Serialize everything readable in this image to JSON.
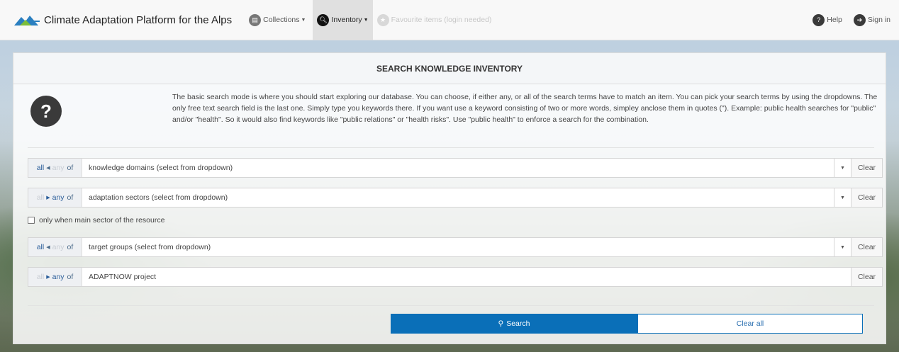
{
  "nav": {
    "brand": "Climate Adaptation Platform for the Alps",
    "collections": "Collections",
    "inventory": "Inventory",
    "favourites": "Favourite items (login needed)",
    "help": "Help",
    "sign_in": "Sign in"
  },
  "panel": {
    "title": "SEARCH KNOWLEDGE INVENTORY",
    "intro": "The basic search mode is where you should start exploring our database. You can choose, if either any, or all of the search terms have to match an item. You can pick your search terms by using the dropdowns. The only free text search field is the last one. Simply type you keywords there. If you want use a keyword consisting of two or more words, simpley anclose them in quotes (\"). Example: public health searches for \"public\" and/or \"health\". So it would also find keywords like \"public relations\" or \"health risks\". Use \"public health\" to enforce a search for the combination."
  },
  "filters": [
    {
      "all": "all",
      "any": "any",
      "of": "of",
      "mode": "all",
      "value": "knowledge domains (select from dropdown)",
      "clear": "Clear"
    },
    {
      "all": "all",
      "any": "any",
      "of": "of",
      "mode": "any",
      "value": "adaptation sectors (select from dropdown)",
      "clear": "Clear"
    },
    {
      "all": "all",
      "any": "any",
      "of": "of",
      "mode": "all",
      "value": "target groups (select from dropdown)",
      "clear": "Clear"
    },
    {
      "all": "all",
      "any": "any",
      "of": "of",
      "mode": "any",
      "value": "ADAPTNOW project",
      "clear": "Clear"
    }
  ],
  "main_sector_checkbox": {
    "label": "only when main sector of the resource",
    "checked": false
  },
  "actions": {
    "search": "Search",
    "clear_all": "Clear all"
  },
  "colors": {
    "primary": "#0a6fb8",
    "accent_link": "#2a5d9a"
  }
}
